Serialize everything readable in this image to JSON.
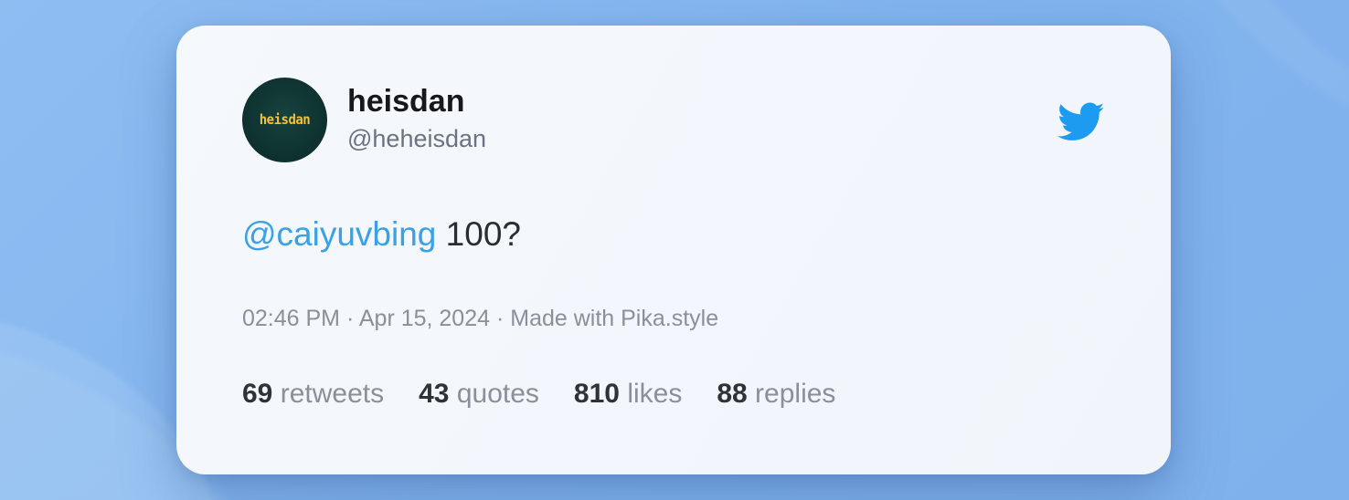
{
  "avatar": {
    "text": "heisdan"
  },
  "user": {
    "name": "heisdan",
    "handle": "@heheisdan"
  },
  "tweet": {
    "mention": "@caiyuvbing",
    "text": " 100?"
  },
  "meta": {
    "time": "02:46 PM",
    "separator": " · ",
    "date": "Apr 15, 2024",
    "source": "Made with Pika.style"
  },
  "stats": [
    {
      "value": "69",
      "label": "retweets"
    },
    {
      "value": "43",
      "label": "quotes"
    },
    {
      "value": "810",
      "label": "likes"
    },
    {
      "value": "88",
      "label": "replies"
    }
  ],
  "icons": {
    "brand": "twitter-bird-icon"
  },
  "colors": {
    "background": "#86b8ef",
    "card": "#f3f6fc",
    "mention": "#3aa0e8",
    "twitter_blue": "#1d9bf0",
    "avatar_bg": "#0f3331",
    "avatar_text": "#f3c33b"
  }
}
